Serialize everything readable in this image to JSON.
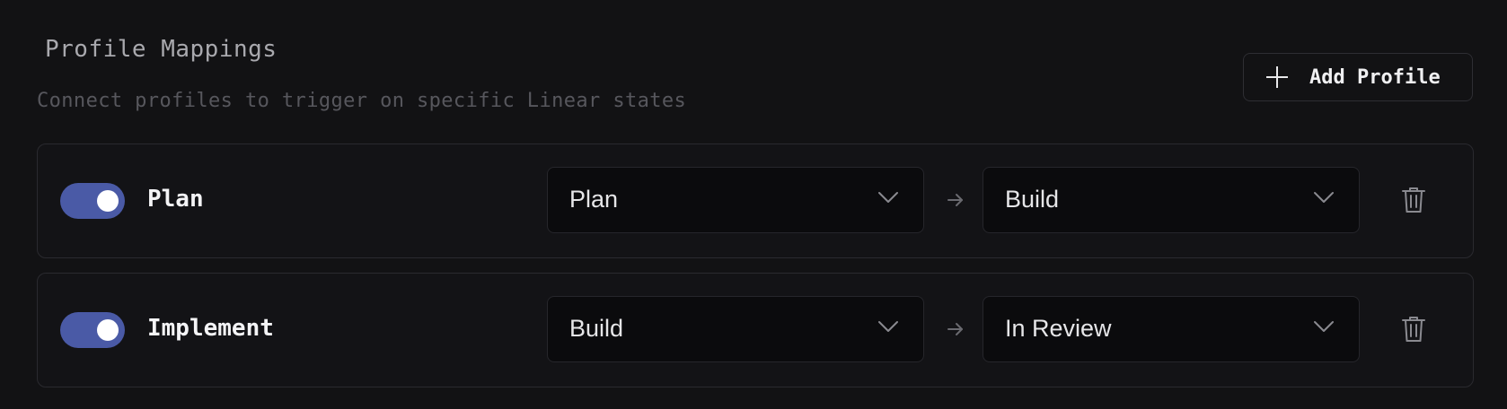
{
  "section": {
    "title": "Profile Mappings",
    "subtitle": "Connect profiles to trigger on specific Linear states"
  },
  "add_button": {
    "label": "Add Profile",
    "icon": "plus-icon"
  },
  "mappings": [
    {
      "enabled": true,
      "name": "Plan",
      "from_state": "Plan",
      "to_state": "Build"
    },
    {
      "enabled": true,
      "name": "Implement",
      "from_state": "Build",
      "to_state": "In Review"
    }
  ],
  "icons": {
    "dropdown": "chevron-down-icon",
    "transition": "arrow-right-icon",
    "delete": "trash-icon"
  },
  "colors": {
    "background": "#121214",
    "toggle_on": "#4a5aa6",
    "border": "#2a2a2f",
    "select_bg": "#0b0b0d"
  }
}
